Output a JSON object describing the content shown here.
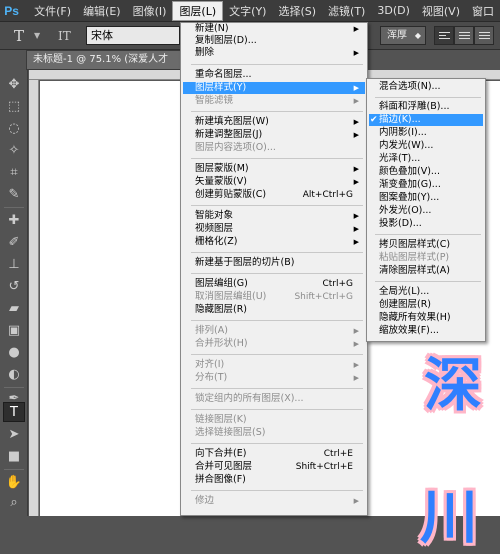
{
  "menubar": {
    "logo": "Ps",
    "items": [
      "文件(F)",
      "编辑(E)",
      "图像(I)",
      "图层(L)",
      "文字(Y)",
      "选择(S)",
      "滤镜(T)",
      "3D(D)",
      "视图(V)",
      "窗口"
    ]
  },
  "options": {
    "tool_glyph": "T",
    "orient_glyph": "IT",
    "font": "宋体",
    "antialias": "浑厚"
  },
  "document": {
    "tab_title": "未标题-1 @ 75.1% (深爱人才"
  },
  "canvas_text": [
    "深",
    "川"
  ],
  "layer_menu": {
    "items": [
      {
        "label": "新建(N)",
        "sub": true
      },
      {
        "label": "复制图层(D)..."
      },
      {
        "label": "删除",
        "sub": true
      },
      {
        "label": "重命名图层..."
      },
      {
        "label": "图层样式(Y)",
        "sub": true,
        "highlight": true
      },
      {
        "label": "智能滤镜",
        "disabled": true,
        "sub": true
      },
      {
        "label": "新建填充图层(W)",
        "sub": true
      },
      {
        "label": "新建调整图层(J)",
        "sub": true
      },
      {
        "label": "图层内容选项(O)...",
        "disabled": true
      },
      {
        "label": "图层蒙版(M)",
        "sub": true
      },
      {
        "label": "矢量蒙版(V)",
        "sub": true
      },
      {
        "label": "创建剪贴蒙版(C)",
        "shortcut": "Alt+Ctrl+G"
      },
      {
        "label": "智能对象",
        "sub": true
      },
      {
        "label": "视频图层",
        "sub": true
      },
      {
        "label": "栅格化(Z)",
        "sub": true
      },
      {
        "label": "新建基于图层的切片(B)"
      },
      {
        "label": "图层编组(G)",
        "shortcut": "Ctrl+G"
      },
      {
        "label": "取消图层编组(U)",
        "shortcut": "Shift+Ctrl+G",
        "disabled": true
      },
      {
        "label": "隐藏图层(R)"
      },
      {
        "label": "排列(A)",
        "disabled": true,
        "sub": true
      },
      {
        "label": "合并形状(H)",
        "disabled": true,
        "sub": true
      },
      {
        "label": "对齐(I)",
        "disabled": true,
        "sub": true
      },
      {
        "label": "分布(T)",
        "disabled": true,
        "sub": true
      },
      {
        "label": "锁定组内的所有图层(X)...",
        "disabled": true
      },
      {
        "label": "链接图层(K)",
        "disabled": true
      },
      {
        "label": "选择链接图层(S)",
        "disabled": true
      },
      {
        "label": "向下合并(E)",
        "shortcut": "Ctrl+E"
      },
      {
        "label": "合并可见图层",
        "shortcut": "Shift+Ctrl+E"
      },
      {
        "label": "拼合图像(F)"
      },
      {
        "label": "修边",
        "disabled": true,
        "sub": true
      }
    ]
  },
  "style_submenu": {
    "items": [
      {
        "label": "混合选项(N)..."
      },
      {
        "label": "斜面和浮雕(B)..."
      },
      {
        "label": "描边(K)...",
        "checked": true,
        "highlight": true
      },
      {
        "label": "内阴影(I)..."
      },
      {
        "label": "内发光(W)..."
      },
      {
        "label": "光泽(T)..."
      },
      {
        "label": "颜色叠加(V)..."
      },
      {
        "label": "渐变叠加(G)..."
      },
      {
        "label": "图案叠加(Y)..."
      },
      {
        "label": "外发光(O)..."
      },
      {
        "label": "投影(D)..."
      },
      {
        "label": "拷贝图层样式(C)"
      },
      {
        "label": "粘贴图层样式(P)",
        "disabled": true
      },
      {
        "label": "清除图层样式(A)"
      },
      {
        "label": "全局光(L)..."
      },
      {
        "label": "创建图层(R)"
      },
      {
        "label": "隐藏所有效果(H)"
      },
      {
        "label": "缩放效果(F)..."
      }
    ],
    "check_glyph": "✔"
  },
  "colors": {
    "highlight": "#3399ff",
    "stroke_pink": "#ffb6c8",
    "text_blue": "#2f7fff"
  }
}
